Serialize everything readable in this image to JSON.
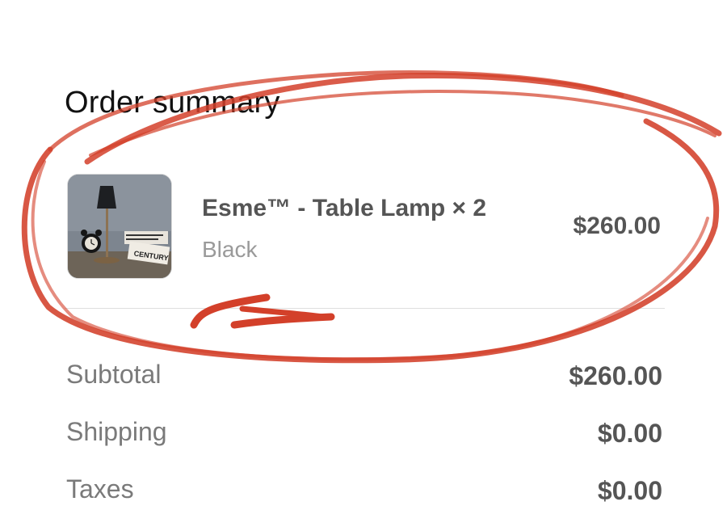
{
  "order_summary": {
    "title": "Order summary",
    "line_item": {
      "thumbnail_icon": "table-lamp-product-image",
      "thumbnail_book_text": "CENTURY",
      "name": "Esme™ - Table Lamp × 2",
      "variant": "Black",
      "price": "$260.00"
    },
    "totals": [
      {
        "label": "Subtotal",
        "value": "$260.00"
      },
      {
        "label": "Shipping",
        "value": "$0.00"
      },
      {
        "label": "Taxes",
        "value": "$0.00"
      }
    ]
  },
  "annotation_color": "#d3402a"
}
